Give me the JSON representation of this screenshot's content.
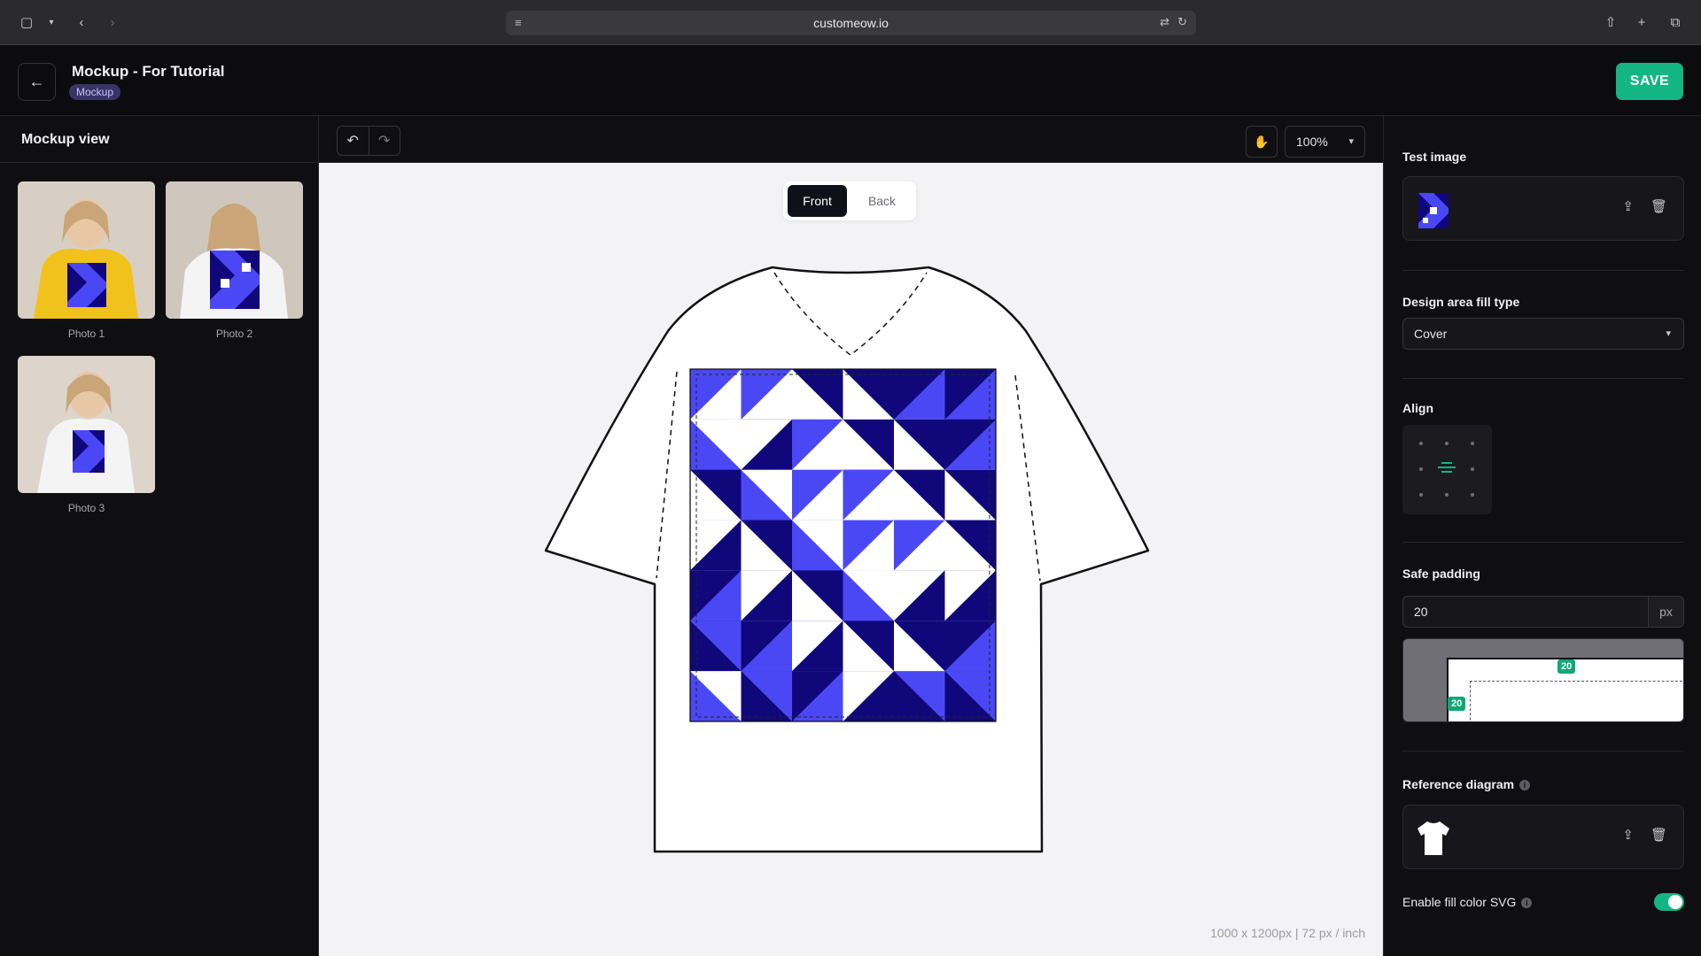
{
  "browser": {
    "url": "customeow.io"
  },
  "header": {
    "title": "Mockup - For Tutorial",
    "badge": "Mockup",
    "save_label": "SAVE"
  },
  "left": {
    "title": "Mockup view",
    "photos": [
      {
        "label": "Photo 1",
        "shirt_color": "#f2c21c"
      },
      {
        "label": "Photo 2",
        "shirt_color": "#f4f4f4"
      },
      {
        "label": "Photo 3",
        "shirt_color": "#f4f4f4"
      }
    ]
  },
  "toolbar": {
    "zoom": "100%"
  },
  "canvas": {
    "tabs": {
      "front": "Front",
      "back": "Back",
      "active": "Front"
    },
    "meta": "1000 x 1200px | 72 px / inch",
    "design_colors": {
      "light": "#4a48f5",
      "dark": "#10087a",
      "white": "#ffffff"
    }
  },
  "right": {
    "test_image_label": "Test image",
    "fill_type_label": "Design area fill type",
    "fill_type_value": "Cover",
    "align_label": "Align",
    "safe_padding_label": "Safe padding",
    "safe_padding_value": "20",
    "safe_padding_unit": "px",
    "preview_top": "20",
    "preview_left": "20",
    "reference_label": "Reference diagram",
    "fill_color_label": "Enable fill color SVG",
    "fill_color_enabled": true
  },
  "colors": {
    "accent": "#13b583",
    "badge_bg": "#3a3466"
  }
}
